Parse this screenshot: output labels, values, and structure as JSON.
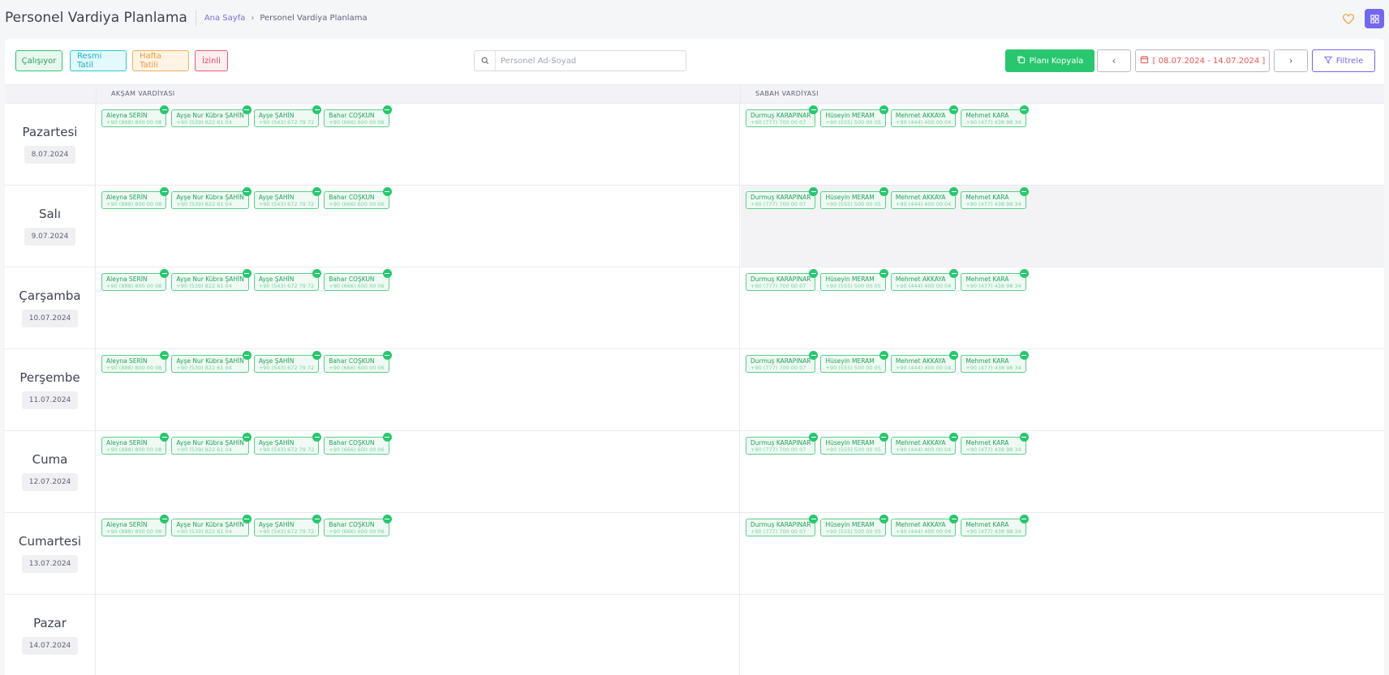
{
  "header": {
    "title": "Personel Vardiya Planlama",
    "breadcrumb_home": "Ana Sayfa",
    "breadcrumb_current": "Personel Vardiya Planlama"
  },
  "legend": {
    "working": "Çalışıyor",
    "public_holiday": "Resmi Tatil",
    "weekend": "Hafta Tatili",
    "leave": "İzinli"
  },
  "search": {
    "placeholder": "Personel Ad-Soyad"
  },
  "toolbar": {
    "copy_label": "Planı Kopyala",
    "date_range": "[ 08.07.2024 - 14.07.2024 ]",
    "filter_label": "Filtrele"
  },
  "columns": {
    "evening": "AKŞAM VARDİYASI",
    "morning": "SABAH VARDİYASI"
  },
  "evening_staff": [
    {
      "name": "Aleyna SERİN",
      "phone": "+90 (888) 800 00 08"
    },
    {
      "name": "Ayşe Nur Kübra ŞAHİN",
      "phone": "+90 (539) 822 61 04"
    },
    {
      "name": "Ayşe ŞAHİN",
      "phone": "+90 (543) 672 79 72"
    },
    {
      "name": "Bahar COŞKUN",
      "phone": "+90 (666) 600 00 06"
    }
  ],
  "morning_staff": [
    {
      "name": "Durmuş KARAPINAR",
      "phone": "+90 (777) 700 00 07"
    },
    {
      "name": "Hüseyin MERAM",
      "phone": "+90 (555) 500 00 05"
    },
    {
      "name": "Mehmet AKKAYA",
      "phone": "+90 (444) 400 00 04"
    },
    {
      "name": "Mehmet KARA",
      "phone": "+90 (477) 438 98 34"
    }
  ],
  "days": [
    {
      "name": "Pazartesi",
      "date": "8.07.2024"
    },
    {
      "name": "Salı",
      "date": "9.07.2024"
    },
    {
      "name": "Çarşamba",
      "date": "10.07.2024"
    },
    {
      "name": "Perşembe",
      "date": "11.07.2024"
    },
    {
      "name": "Cuma",
      "date": "12.07.2024"
    },
    {
      "name": "Cumartesi",
      "date": "13.07.2024"
    },
    {
      "name": "Pazar",
      "date": "14.07.2024"
    }
  ],
  "colors": {
    "accent": "#7367f0",
    "success": "#28c76f",
    "danger": "#ea5455"
  },
  "icons": [
    "heart-icon",
    "apps-grid-icon",
    "search-icon",
    "copy-icon",
    "chevron-left-icon",
    "calendar-icon",
    "chevron-right-icon",
    "filter-icon",
    "remove-icon"
  ]
}
